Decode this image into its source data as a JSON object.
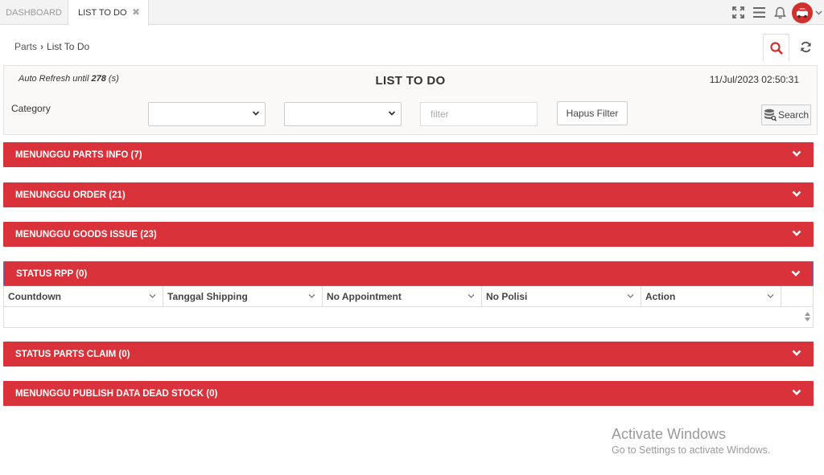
{
  "tabs": [
    {
      "label": "DASHBOARD"
    },
    {
      "label": "LIST TO DO",
      "close": "✖"
    }
  ],
  "breadcrumb": {
    "parent": "Parts",
    "separator": "›",
    "current": "List To Do"
  },
  "panel": {
    "auto_refresh_prefix": "Auto Refresh until",
    "auto_refresh_value": "278",
    "auto_refresh_unit": "(s)",
    "title": "LIST TO DO",
    "timestamp": "11/Jul/2023 02:50:31",
    "category_label": "Category",
    "filter_placeholder": "filter",
    "hapus_filter_label": "Hapus Filter",
    "search_label": "Search"
  },
  "sections": [
    {
      "label": "MENUNGGU PARTS INFO (7)"
    },
    {
      "label": "MENUNGGU ORDER (21)"
    },
    {
      "label": "MENUNGGU GOODS ISSUE (23)"
    },
    {
      "label": "STATUS RPP (0)"
    },
    {
      "label": "STATUS PARTS CLAIM (0)"
    },
    {
      "label": "MENUNGGU PUBLISH DATA DEAD STOCK (0)"
    }
  ],
  "grid": {
    "columns": [
      "Countdown",
      "Tanggal Shipping",
      "No Appointment",
      "No Polisi",
      "Action"
    ]
  },
  "watermark": {
    "title": "Activate Windows",
    "subtitle": "Go to Settings to activate Windows."
  },
  "colors": {
    "section_red": "#d9323a",
    "accent_red": "#d32f2f"
  }
}
